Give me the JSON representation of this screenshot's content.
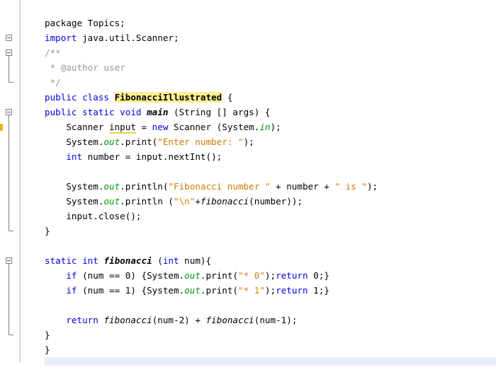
{
  "editor": {
    "lines": [
      [
        {
          "t": "package Topics;"
        }
      ],
      [
        {
          "t": "import",
          "c": "kw"
        },
        {
          "t": " java.util.Scanner;"
        }
      ],
      [
        {
          "t": "/**",
          "c": "cm"
        }
      ],
      [
        {
          "t": " * @author user",
          "c": "cm"
        }
      ],
      [
        {
          "t": " */",
          "c": "cm"
        }
      ],
      [
        {
          "t": "public class",
          "c": "kw"
        },
        {
          "t": " "
        },
        {
          "t": "FibonacciIllustrated",
          "c": "hl"
        },
        {
          "t": " {"
        }
      ],
      [
        {
          "t": "public static void",
          "c": "kw"
        },
        {
          "t": " "
        },
        {
          "t": "main",
          "c": "bi"
        },
        {
          "t": " (String [] args) {"
        }
      ],
      [
        {
          "t": "    Scanner "
        },
        {
          "t": "input",
          "c": "ul"
        },
        {
          "t": " = "
        },
        {
          "t": "new",
          "c": "kw"
        },
        {
          "t": " Scanner (System."
        },
        {
          "t": "in",
          "c": "fld"
        },
        {
          "t": ");"
        }
      ],
      [
        {
          "t": "    System."
        },
        {
          "t": "out",
          "c": "fld"
        },
        {
          "t": ".print("
        },
        {
          "t": "\"Enter number: \"",
          "c": "str"
        },
        {
          "t": ");"
        }
      ],
      [
        {
          "t": "    "
        },
        {
          "t": "int",
          "c": "kw"
        },
        {
          "t": " number = input.nextInt();"
        }
      ],
      [],
      [
        {
          "t": "    System."
        },
        {
          "t": "out",
          "c": "fld"
        },
        {
          "t": ".println("
        },
        {
          "t": "\"Fibonacci number \"",
          "c": "str"
        },
        {
          "t": " + number + "
        },
        {
          "t": "\" is \"",
          "c": "str"
        },
        {
          "t": ");"
        }
      ],
      [
        {
          "t": "    System."
        },
        {
          "t": "out",
          "c": "fld"
        },
        {
          "t": ".println ("
        },
        {
          "t": "\"\\n\"",
          "c": "str"
        },
        {
          "t": "+"
        },
        {
          "t": "fibonacci",
          "c": "it"
        },
        {
          "t": "(number));"
        }
      ],
      [
        {
          "t": "    input.close();"
        }
      ],
      [
        {
          "t": "}"
        }
      ],
      [],
      [
        {
          "t": "static int",
          "c": "kw"
        },
        {
          "t": " "
        },
        {
          "t": "fibonacci",
          "c": "bi"
        },
        {
          "t": " ("
        },
        {
          "t": "int",
          "c": "kw"
        },
        {
          "t": " num){"
        }
      ],
      [
        {
          "t": "    "
        },
        {
          "t": "if",
          "c": "kw"
        },
        {
          "t": " (num == 0) {System."
        },
        {
          "t": "out",
          "c": "fld"
        },
        {
          "t": ".print("
        },
        {
          "t": "\"* 0\"",
          "c": "str"
        },
        {
          "t": ");"
        },
        {
          "t": "return",
          "c": "kw"
        },
        {
          "t": " 0;}"
        }
      ],
      [
        {
          "t": "    "
        },
        {
          "t": "if",
          "c": "kw"
        },
        {
          "t": " (num == 1) {System."
        },
        {
          "t": "out",
          "c": "fld"
        },
        {
          "t": ".print("
        },
        {
          "t": "\"* 1\"",
          "c": "str"
        },
        {
          "t": ");"
        },
        {
          "t": "return",
          "c": "kw"
        },
        {
          "t": " 1;}"
        }
      ],
      [],
      [
        {
          "t": "    "
        },
        {
          "t": "return",
          "c": "kw"
        },
        {
          "t": " "
        },
        {
          "t": "fibonacci",
          "c": "it"
        },
        {
          "t": "(num-2) + "
        },
        {
          "t": "fibonacci",
          "c": "it"
        },
        {
          "t": "(num-1);"
        }
      ],
      [
        {
          "t": "}"
        }
      ],
      [
        {
          "t": "}"
        }
      ]
    ],
    "fold_markers": [
      {
        "line": 1,
        "name": "fold-import-icon",
        "end": null
      },
      {
        "line": 2,
        "name": "fold-comment-icon",
        "end": 4
      },
      {
        "line": 6,
        "name": "fold-main-method-icon",
        "end": 14
      },
      {
        "line": 16,
        "name": "fold-fibonacci-method-icon",
        "end": 21
      }
    ]
  }
}
